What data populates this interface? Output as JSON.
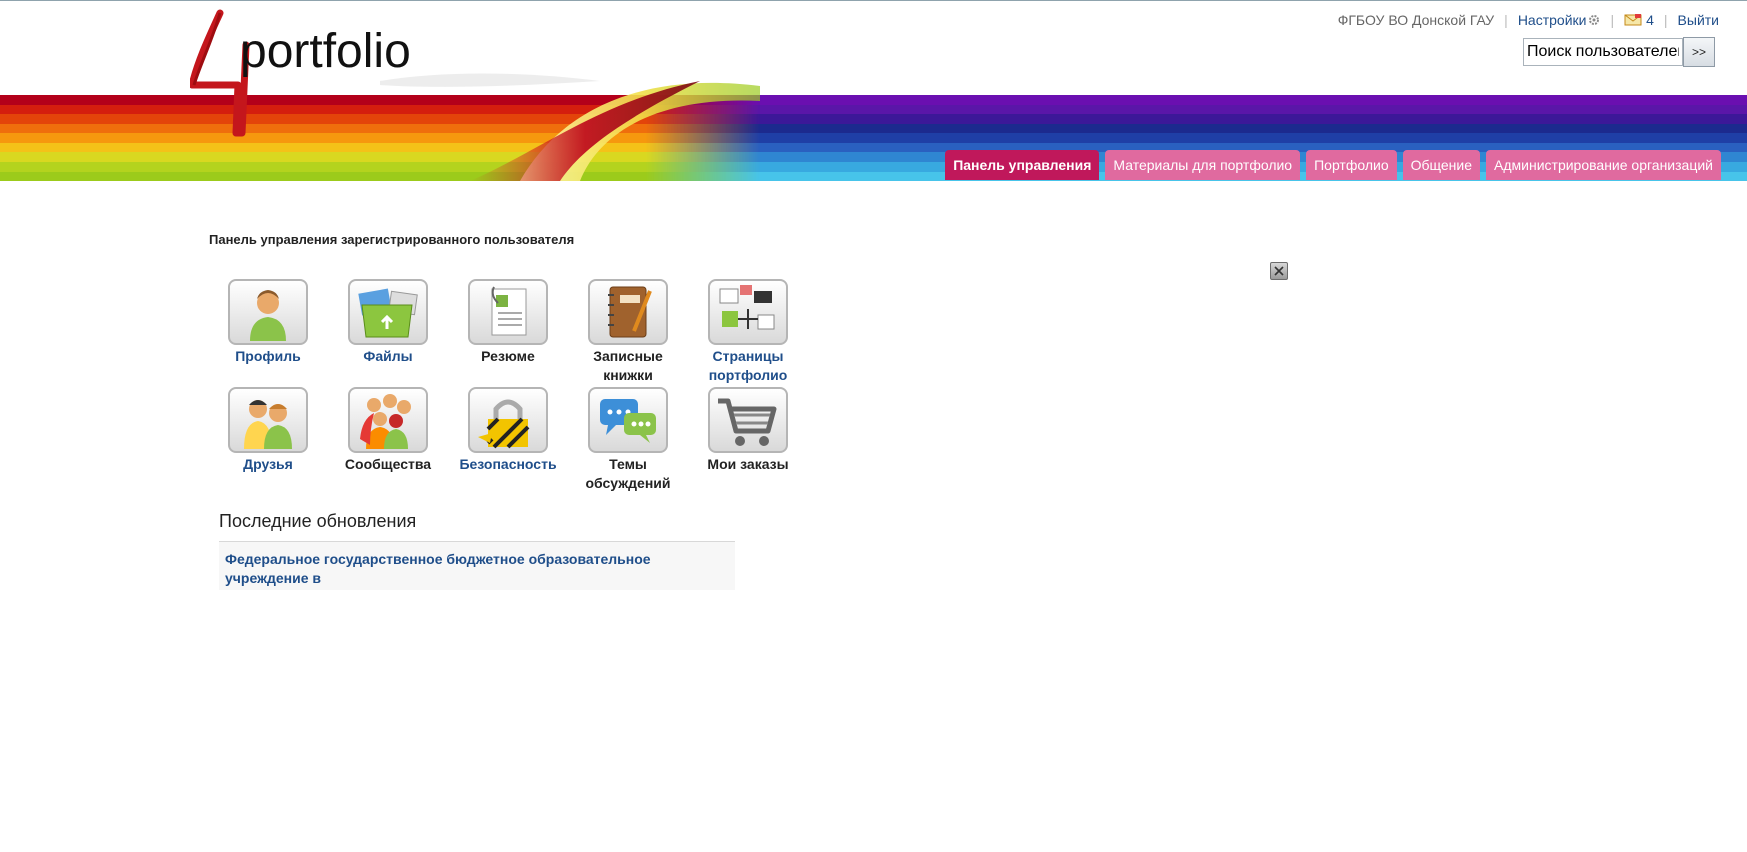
{
  "header": {
    "logo_text": "portfolio",
    "logo_digit": "4",
    "org_name": "ФГБОУ ВО Донской ГАУ",
    "settings_label": "Настройки",
    "messages_count": "4",
    "logout_label": "Выйти",
    "search_placeholder": "Поиск пользователей",
    "search_button": ">>"
  },
  "nav": {
    "tabs": [
      {
        "label": "Панель управления",
        "active": true
      },
      {
        "label": "Материалы для портфолио",
        "active": false
      },
      {
        "label": "Портфолио",
        "active": false
      },
      {
        "label": "Общение",
        "active": false
      },
      {
        "label": "Администрирование организаций",
        "active": false
      }
    ]
  },
  "main": {
    "title": "Панель управления зарегистрированного пользователя",
    "tiles": [
      {
        "label": "Профиль",
        "icon": "profile-icon",
        "link": true
      },
      {
        "label": "Файлы",
        "icon": "files-icon",
        "link": true
      },
      {
        "label": "Резюме",
        "icon": "resume-icon",
        "link": false
      },
      {
        "label": "Записные книжки",
        "icon": "notebook-icon",
        "link": false
      },
      {
        "label": "Страницы портфолио",
        "icon": "portfolio-pages-icon",
        "link": true
      },
      {
        "label": "Друзья",
        "icon": "friends-icon",
        "link": true
      },
      {
        "label": "Сообщества",
        "icon": "communities-icon",
        "link": false
      },
      {
        "label": "Безопасность",
        "icon": "security-icon",
        "link": true
      },
      {
        "label": "Темы обсуждений",
        "icon": "discussions-icon",
        "link": false
      },
      {
        "label": "Мои заказы",
        "icon": "cart-icon",
        "link": false
      }
    ],
    "updates_title": "Последние обновления",
    "updates": [
      {
        "text": "Федеральное государственное бюджетное образовательное учреждение в"
      }
    ]
  },
  "colors": {
    "tab_active": "#c0185b",
    "tab": "#e06a9f",
    "link": "#1f4e8a"
  }
}
